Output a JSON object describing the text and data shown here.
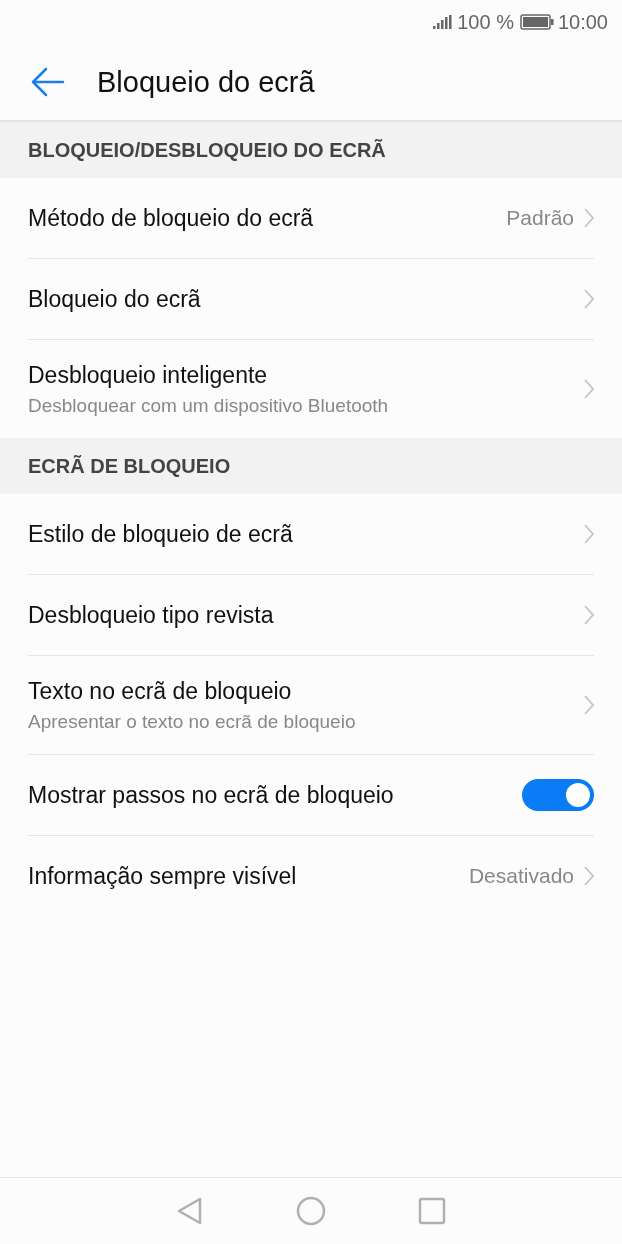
{
  "status_bar": {
    "battery": "100 %",
    "time": "10:00"
  },
  "header": {
    "title": "Bloqueio do ecrã"
  },
  "sections": [
    {
      "title": "BLOQUEIO/DESBLOQUEIO DO ECRÃ",
      "items": [
        {
          "kind": "link",
          "label": "Método de bloqueio do ecrã",
          "value": "Padrão"
        },
        {
          "kind": "link",
          "label": "Bloqueio do ecrã"
        },
        {
          "kind": "link",
          "label": "Desbloqueio inteligente",
          "subtitle": "Desbloquear com um dispositivo Bluetooth"
        }
      ]
    },
    {
      "title": "ECRÃ DE BLOQUEIO",
      "items": [
        {
          "kind": "link",
          "label": "Estilo de bloqueio de ecrã"
        },
        {
          "kind": "link",
          "label": "Desbloqueio tipo revista"
        },
        {
          "kind": "link",
          "label": "Texto no ecrã de bloqueio",
          "subtitle": "Apresentar o texto no ecrã de bloqueio"
        },
        {
          "kind": "toggle",
          "label": "Mostrar passos no ecrã de bloqueio",
          "on": true
        },
        {
          "kind": "link",
          "label": "Informação sempre visível",
          "value": "Desativado"
        }
      ]
    }
  ]
}
